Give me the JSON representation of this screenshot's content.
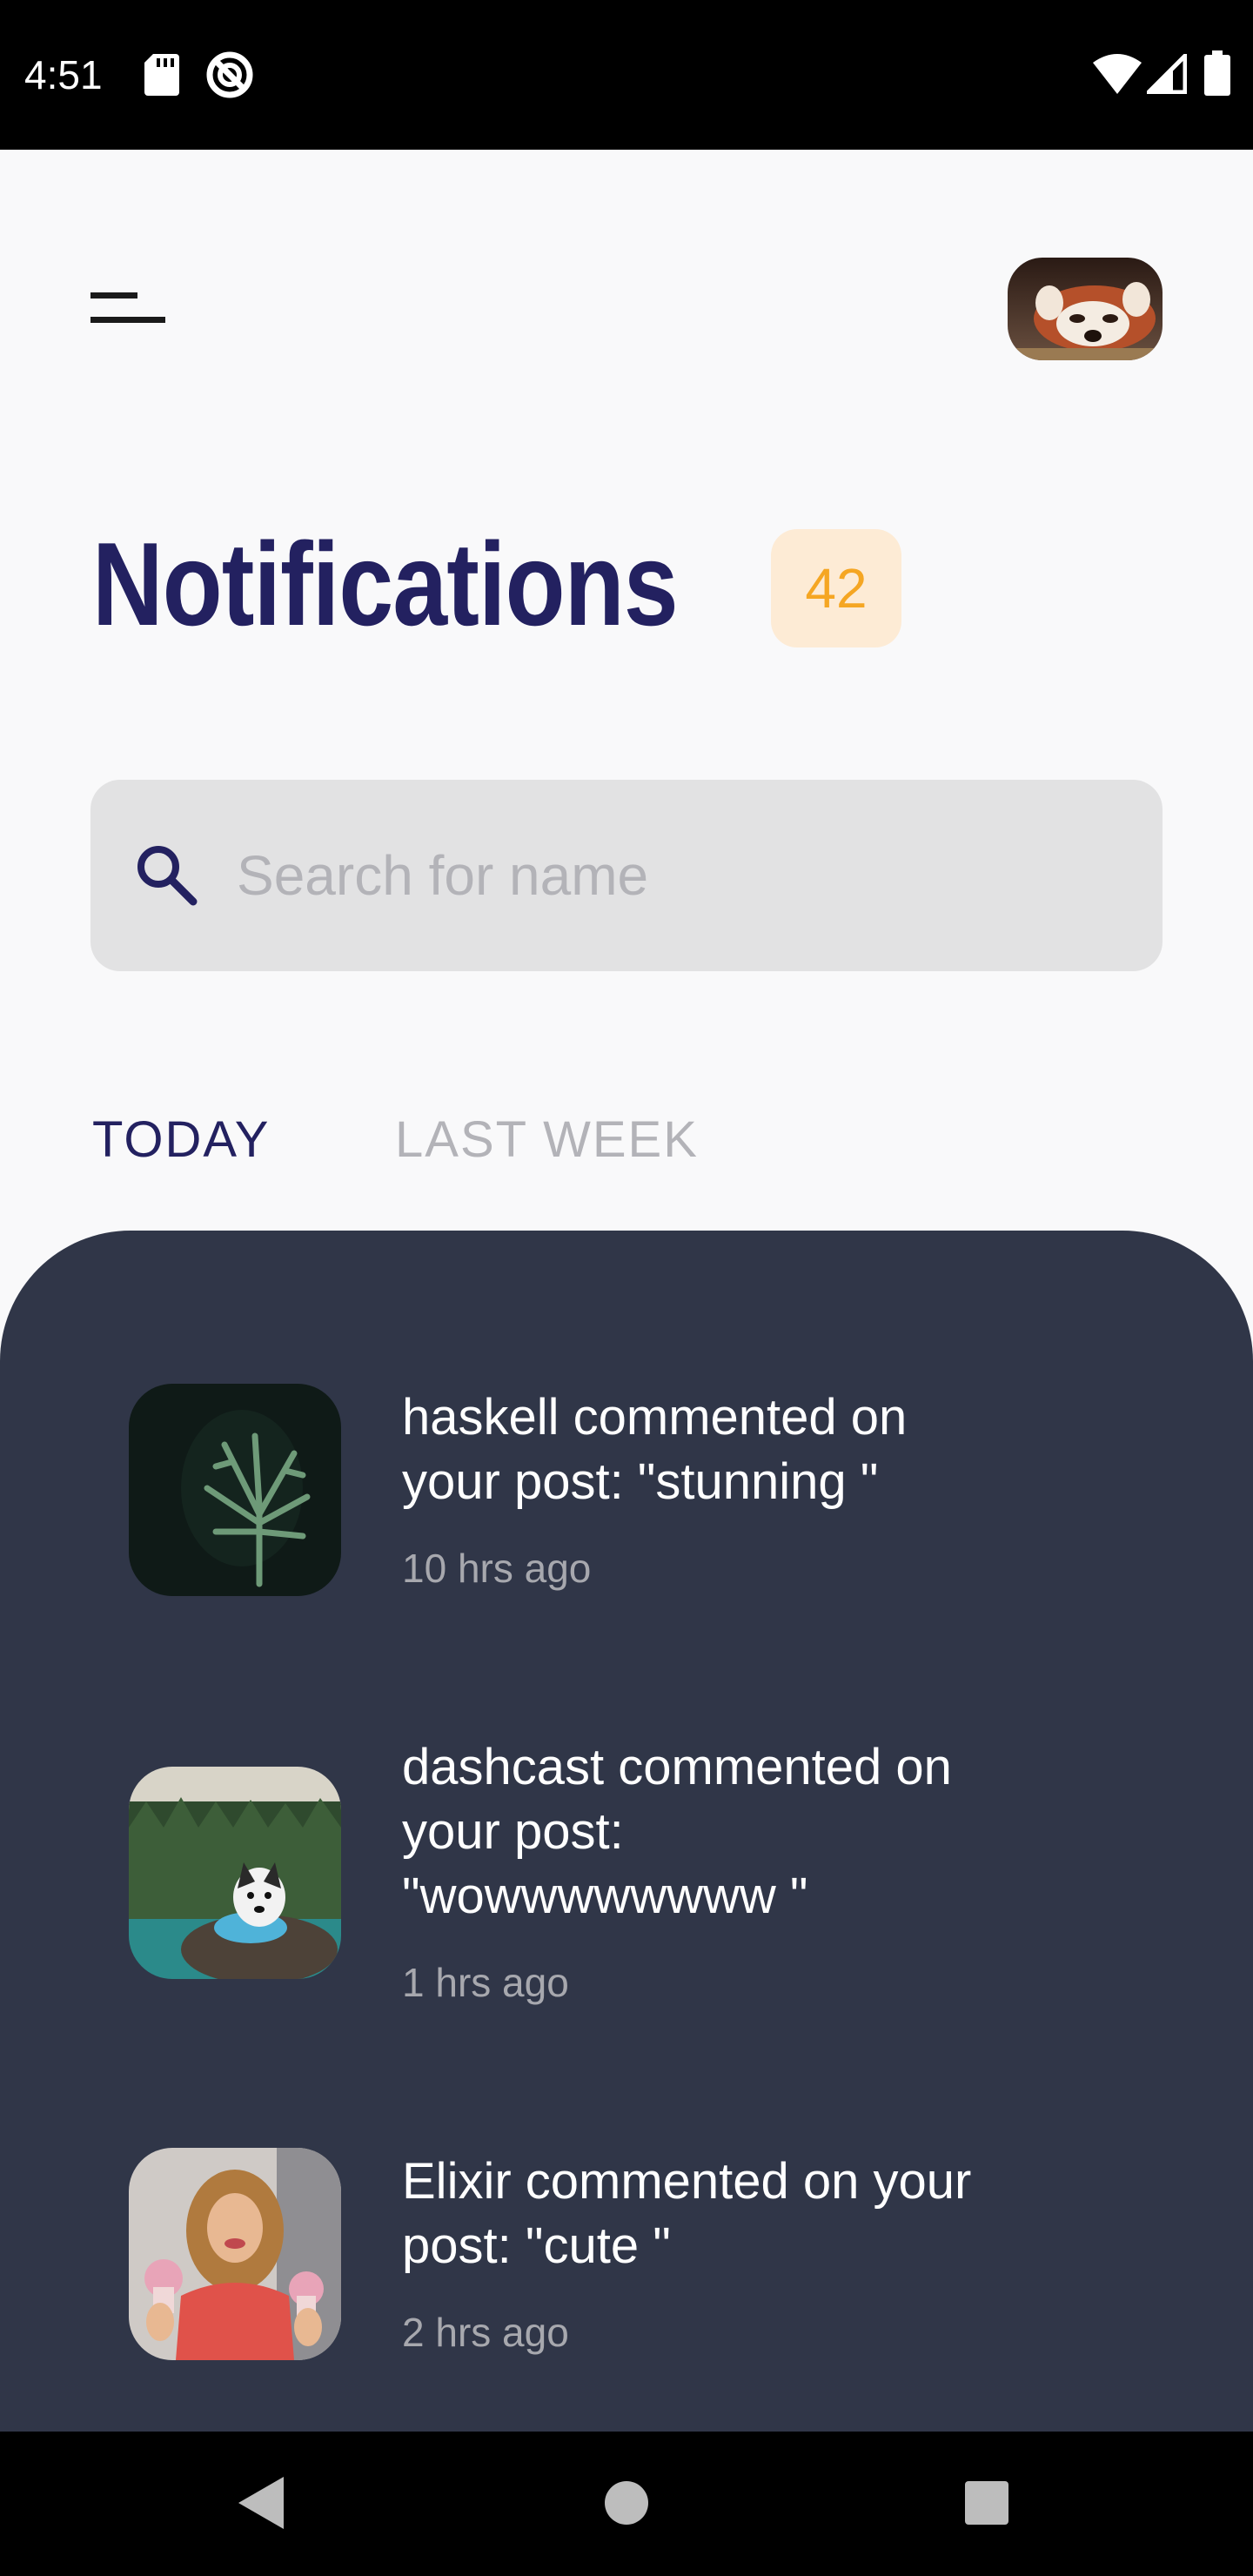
{
  "status_bar": {
    "time": "4:51",
    "icons": [
      "sd-card-icon",
      "do-not-disturb-icon",
      "wifi-icon",
      "cell-signal-icon",
      "battery-icon"
    ]
  },
  "header": {
    "menu_icon": "menu-icon",
    "avatar": "red-panda-avatar"
  },
  "title": "Notifications",
  "badge_count": "42",
  "search": {
    "placeholder": "Search for name",
    "value": ""
  },
  "tabs": [
    {
      "label": "TODAY",
      "active": true
    },
    {
      "label": "LAST WEEK",
      "active": false
    }
  ],
  "notifications": [
    {
      "text": "haskell commented on your post: \"stunning \"",
      "time": "10 hrs ago",
      "thumb": "plant-photo"
    },
    {
      "text": "dashcast commented on your post: \"wowwwwwwww \"",
      "time": "1 hrs ago",
      "thumb": "husky-lake-photo"
    },
    {
      "text": "Elixir commented on your post: \"cute \"",
      "time": "2 hrs ago",
      "thumb": "woman-cupcakes-photo"
    }
  ],
  "colors": {
    "title": "#232160",
    "badge_bg": "#fdebd5",
    "badge_text": "#f5a623",
    "panel": "#303648",
    "search_bg": "#e2e2e3",
    "tab_inactive": "#b3b3b8"
  }
}
